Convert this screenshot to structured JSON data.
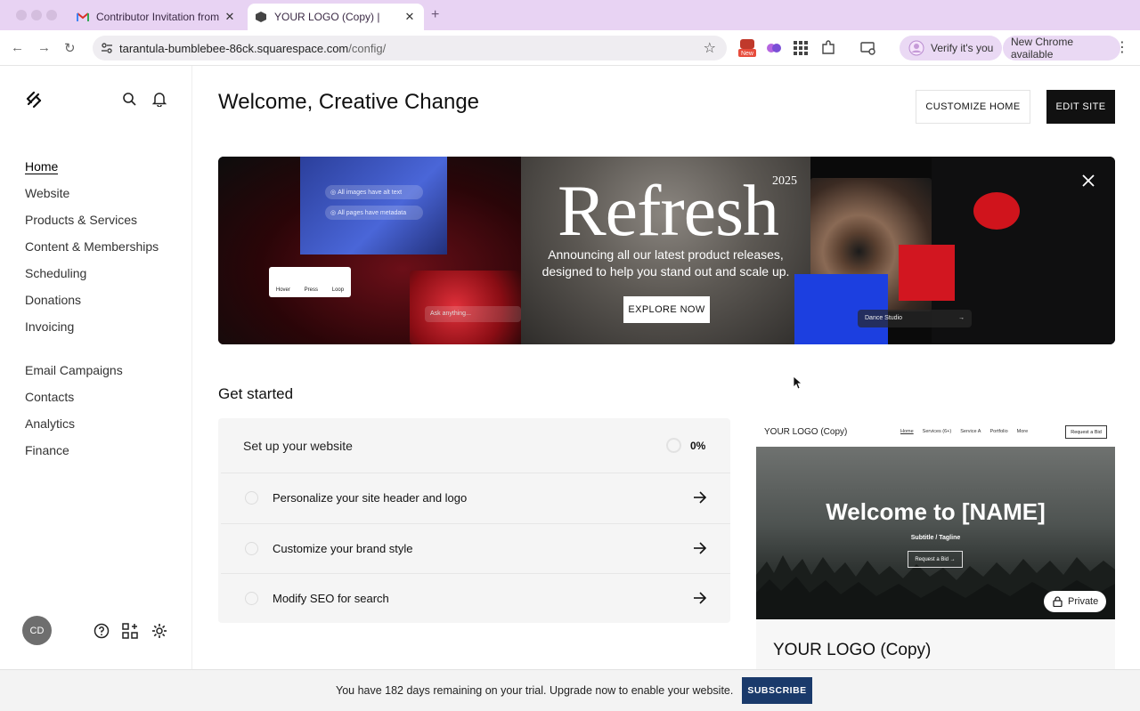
{
  "browser": {
    "tabs": [
      {
        "title": "Contributor Invitation from El",
        "close": "✕"
      },
      {
        "title": "YOUR LOGO (Copy) |",
        "close": "✕"
      }
    ],
    "new_tab": "+",
    "url_host": "tarantula-bumblebee-86ck.squarespace.com",
    "url_path": "/config/",
    "verify_label": "Verify it's you",
    "update_label": "New Chrome available",
    "new_badge": "New"
  },
  "sidebar": {
    "nav_primary": [
      "Home",
      "Website",
      "Products & Services",
      "Content & Memberships",
      "Scheduling",
      "Donations",
      "Invoicing"
    ],
    "nav_secondary": [
      "Email Campaigns",
      "Contacts",
      "Analytics",
      "Finance"
    ],
    "avatar_initials": "CD"
  },
  "header": {
    "title": "Welcome, Creative Change",
    "customize_label": "CUSTOMIZE HOME",
    "edit_label": "EDIT SITE"
  },
  "banner": {
    "headline": "Refresh",
    "year": "2025",
    "subtitle": "Announcing all our latest product releases, designed to help you stand out and scale up.",
    "cta": "EXPLORE NOW",
    "chip_1": "All images have alt text",
    "chip_2": "All pages have metadata",
    "hover_labels": [
      "Hover",
      "Press",
      "Loop"
    ],
    "ask_placeholder": "Ask anything...",
    "dance_label": "Dance Studio"
  },
  "get_started": {
    "heading": "Get started",
    "card_title": "Set up your website",
    "progress_percent": 0,
    "progress_label": "0%",
    "tasks": [
      "Personalize your site header and logo",
      "Customize your brand style",
      "Modify SEO for search"
    ]
  },
  "preview": {
    "logo": "YOUR LOGO (Copy)",
    "nav": [
      "Home",
      "Services (6+)",
      "Service A",
      "Portfolio",
      "More"
    ],
    "bid_button": "Request a Bid",
    "hero_title": "Welcome to [NAME]",
    "hero_sub": "Subtitle / Tagline",
    "hero_cta": "Request a Bid →",
    "private_label": "Private",
    "site_name": "YOUR LOGO (Copy)"
  },
  "trial": {
    "message": "You have 182 days remaining on your trial. Upgrade now to enable your website.",
    "subscribe_label": "SUBSCRIBE"
  },
  "colors": {
    "tabbar": "#e8d3f3",
    "edit_button": "#111111",
    "subscribe_button": "#1a3a6b"
  }
}
